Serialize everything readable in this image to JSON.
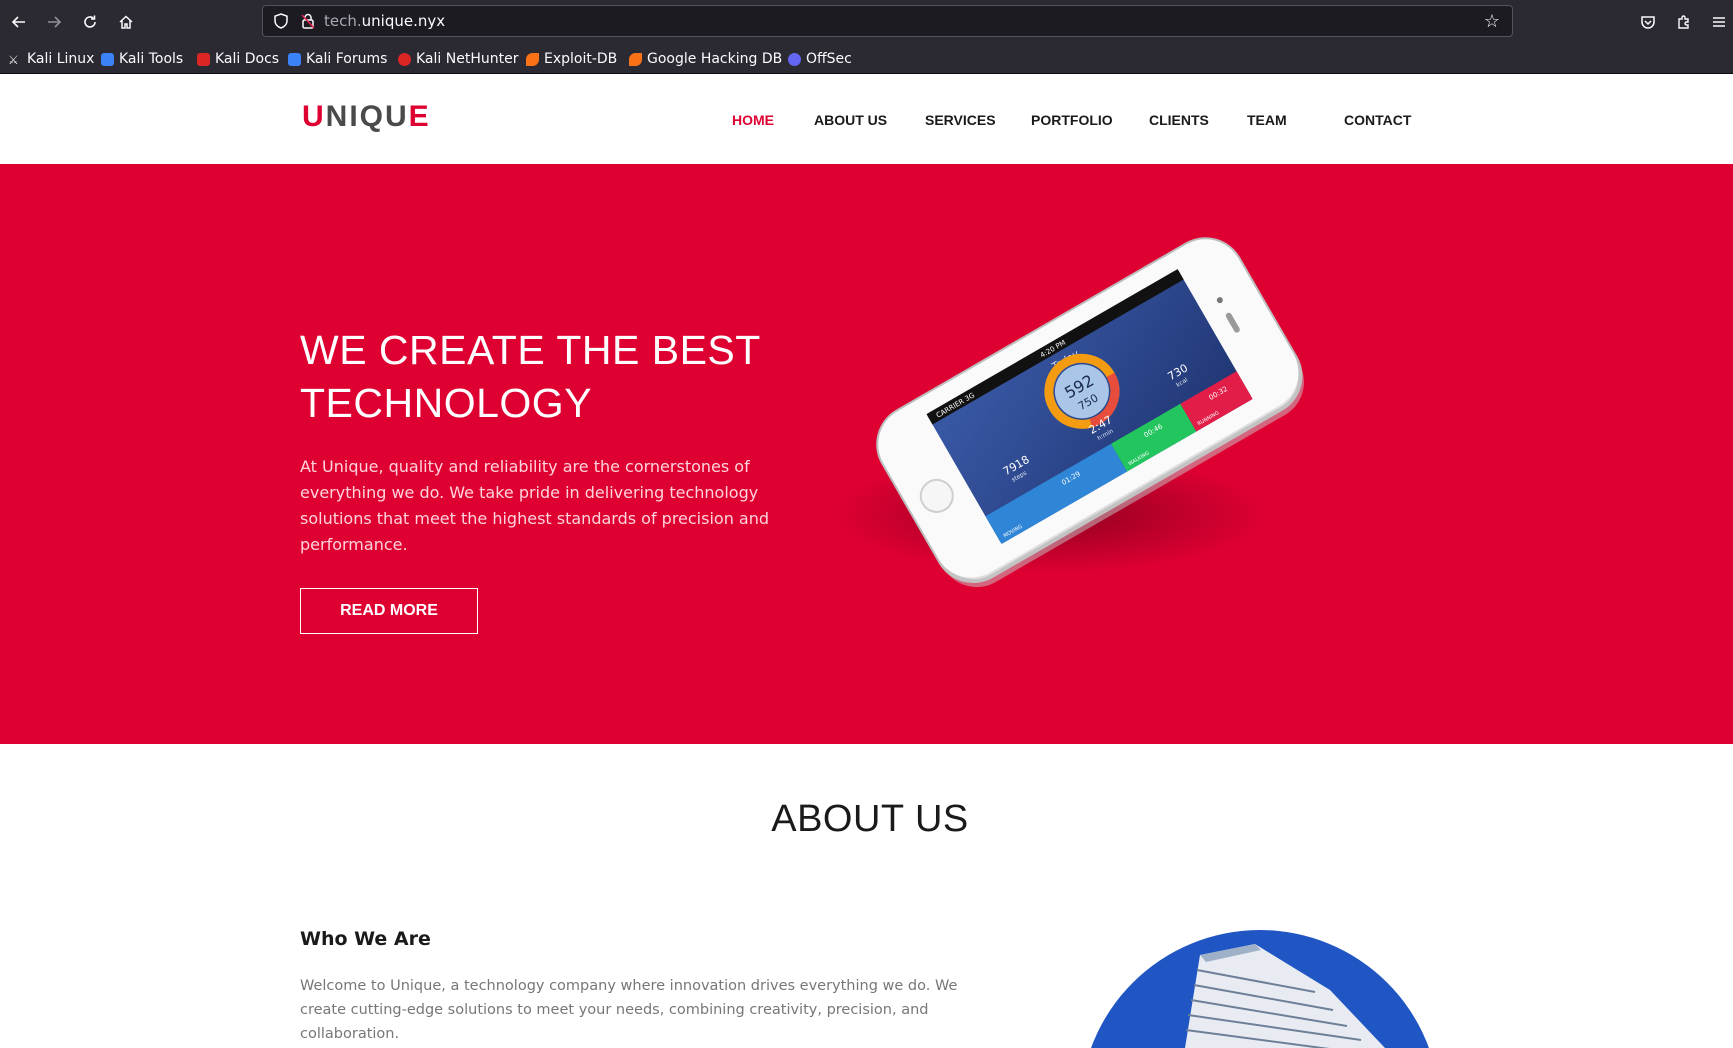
{
  "browser": {
    "url_subdomain": "tech.",
    "url_domain": "unique.nyx",
    "bookmarks": [
      {
        "label": "Kali Linux",
        "icon": "kali-dragon-icon",
        "color": "#e8e8e8"
      },
      {
        "label": "Kali Tools",
        "icon": "kali-tools-icon",
        "color": "#3b82f6"
      },
      {
        "label": "Kali Docs",
        "icon": "kali-docs-icon",
        "color": "#dc2626"
      },
      {
        "label": "Kali Forums",
        "icon": "kali-forums-icon",
        "color": "#3b82f6"
      },
      {
        "label": "Kali NetHunter",
        "icon": "nethunter-icon",
        "color": "#dc2626"
      },
      {
        "label": "Exploit-DB",
        "icon": "exploit-db-icon",
        "color": "#f97316"
      },
      {
        "label": "Google Hacking DB",
        "icon": "ghdb-icon",
        "color": "#f97316"
      },
      {
        "label": "OffSec",
        "icon": "offsec-icon",
        "color": "#6366f1"
      }
    ]
  },
  "site": {
    "logo": {
      "first": "U",
      "middle": "NIQU",
      "last": "E"
    },
    "menu": [
      "HOME",
      "ABOUT US",
      "SERVICES",
      "PORTFOLIO",
      "CLIENTS",
      "TEAM",
      "CONTACT"
    ],
    "active_menu": "HOME",
    "accent_color": "#df0032"
  },
  "hero": {
    "title_line1": "WE CREATE THE BEST",
    "title_line2": "TECHNOLOGY",
    "text": "At Unique, quality and reliability are the cornerstones of everything we do. We take pride in delivering technology solutions that meet the highest standards of precision and performance.",
    "button": "READ MORE",
    "phone_screen": {
      "carrier": "CARRIER 3G",
      "time": "4:20 PM",
      "heading": "Today",
      "ring_value": "592",
      "ring_goal": "750",
      "steps_value": "7918",
      "steps_label": "steps",
      "time_value": "2:47",
      "time_label": "h:min",
      "kcal_value": "730",
      "kcal_label": "kcal",
      "moving_label": "MOVING",
      "moving_time": "01:29",
      "walking_label": "WALKING",
      "walking_time": "00:46",
      "running_label": "RUNNING",
      "running_time": "00:32"
    }
  },
  "about": {
    "title": "ABOUT US",
    "who_title": "Who We Are",
    "who_text": "Welcome to Unique, a technology company where innovation drives everything we do. We create cutting-edge solutions to meet your needs, combining creativity, precision, and collaboration."
  }
}
